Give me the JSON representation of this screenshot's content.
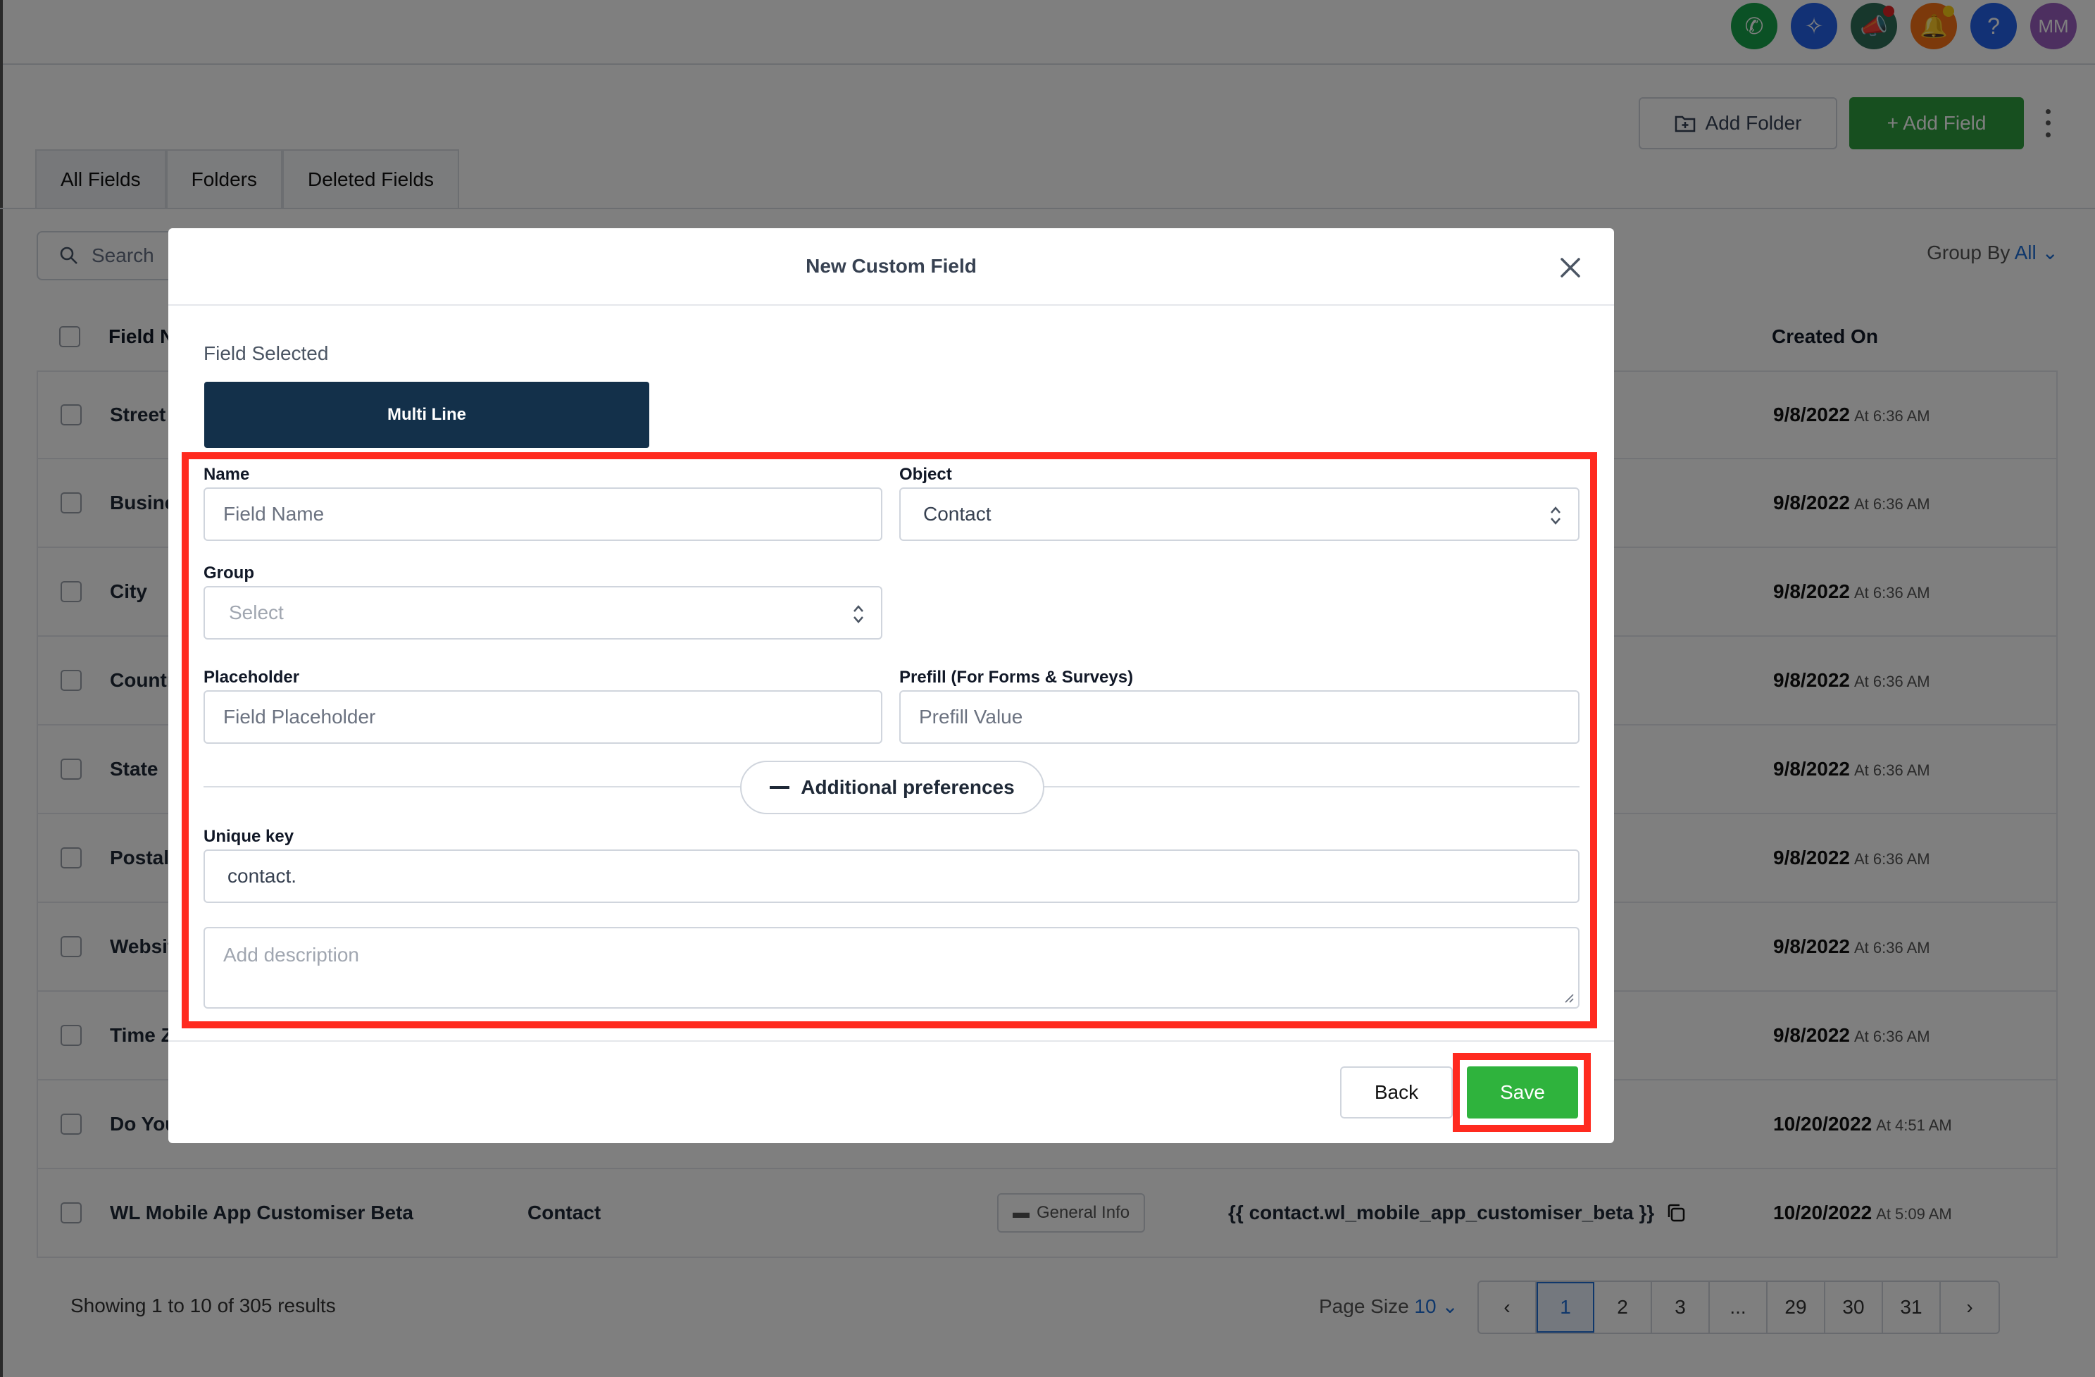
{
  "topbar": {
    "icons": [
      {
        "name": "phone-icon",
        "color": "#17a34a",
        "glyph": "✆"
      },
      {
        "name": "sparkle-icon",
        "color": "#2563eb",
        "glyph": "✧"
      },
      {
        "name": "megaphone-icon",
        "color": "#2f6f58",
        "glyph": "📣",
        "badge": "#e02424"
      },
      {
        "name": "bell-icon",
        "color": "#f97316",
        "glyph": "🔔",
        "badge": "#facc15"
      },
      {
        "name": "help-icon",
        "color": "#2563eb",
        "glyph": "?"
      },
      {
        "name": "avatar",
        "color": "#9b5fc0",
        "glyph": "MM"
      }
    ]
  },
  "toolbar": {
    "add_folder": "Add Folder",
    "add_field": "+ Add Field"
  },
  "tabs": [
    "All Fields",
    "Folders",
    "Deleted Fields"
  ],
  "search": {
    "placeholder": "Search"
  },
  "group_by": {
    "label": "Group By",
    "value": "All"
  },
  "table": {
    "headers": {
      "name": "Field N",
      "created_on": "Created On"
    },
    "rows": [
      {
        "name": "Street A",
        "date": "9/8/2022",
        "time": "At 6:36 AM"
      },
      {
        "name": "Busines",
        "date": "9/8/2022",
        "time": "At 6:36 AM"
      },
      {
        "name": "City",
        "date": "9/8/2022",
        "time": "At 6:36 AM"
      },
      {
        "name": "Countr",
        "date": "9/8/2022",
        "time": "At 6:36 AM"
      },
      {
        "name": "State",
        "date": "9/8/2022",
        "time": "At 6:36 AM"
      },
      {
        "name": "Postal (",
        "date": "9/8/2022",
        "time": "At 6:36 AM"
      },
      {
        "name": "Websit",
        "date": "9/8/2022",
        "time": "At 6:36 AM"
      },
      {
        "name": "Time Z",
        "date": "9/8/2022",
        "time": "At 6:36 AM"
      },
      {
        "name": "Do You",
        "date": "10/20/2022",
        "time": "At 4:51 AM"
      },
      {
        "name": "WL Mobile App Customiser Beta",
        "object": "Contact",
        "group": "General Info",
        "key": "{{ contact.wl_mobile_app_customiser_beta }}",
        "date": "10/20/2022",
        "time": "At 5:09 AM"
      }
    ]
  },
  "footer": {
    "showing": "Showing 1 to 10 of 305 results",
    "page_size_label": "Page Size",
    "page_size_value": "10",
    "pages": [
      "‹",
      "1",
      "2",
      "3",
      "...",
      "29",
      "30",
      "31",
      "›"
    ],
    "current_page": "1"
  },
  "modal": {
    "title": "New Custom Field",
    "field_selected_label": "Field Selected",
    "field_type": "Multi Line",
    "name_label": "Name",
    "name_placeholder": "Field Name",
    "object_label": "Object",
    "object_value": "Contact",
    "group_label": "Group",
    "group_placeholder": "Select",
    "placeholder_label": "Placeholder",
    "placeholder_placeholder": "Field Placeholder",
    "prefill_label": "Prefill (For Forms & Surveys)",
    "prefill_placeholder": "Prefill Value",
    "additional_preferences": "Additional preferences",
    "unique_key_label": "Unique key",
    "unique_key_value": "contact.",
    "description_placeholder": "Add description",
    "back": "Back",
    "save": "Save"
  },
  "colors": {
    "primary_green": "#2e9e3e",
    "save_green": "#2fb33d",
    "highlight_red": "#ff2a1f",
    "field_type_bg": "#13304a",
    "link_blue": "#1f6fd6"
  }
}
